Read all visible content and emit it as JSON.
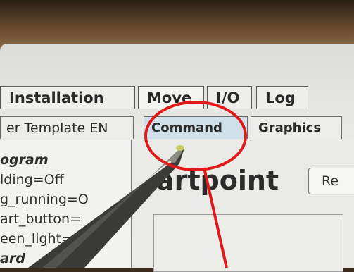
{
  "tabs_primary": [
    {
      "label": "Installation",
      "active": false
    },
    {
      "label": "Move",
      "active": true
    },
    {
      "label": "I/O",
      "active": false
    },
    {
      "label": "Log",
      "active": false
    }
  ],
  "tabs_secondary": [
    {
      "label": "er Template EN",
      "active": false
    },
    {
      "label": "Command",
      "active": true
    },
    {
      "label": "Graphics",
      "active": false
    }
  ],
  "program_tree": [
    {
      "label": "ogram",
      "bold": true
    },
    {
      "label": "lding=Off",
      "bold": false
    },
    {
      "label": "g_running=O",
      "bold": false
    },
    {
      "label": "art_button=",
      "bold": false
    },
    {
      "label": "een_light=",
      "bold": false
    },
    {
      "label": "ard",
      "bold": true
    }
  ],
  "content": {
    "title": "artpoint",
    "button_label": "Re"
  },
  "colors": {
    "annotation_circle": "#e01a1a",
    "annotation_line": "#e01a1a",
    "active_tab": "#cfe0ea"
  }
}
